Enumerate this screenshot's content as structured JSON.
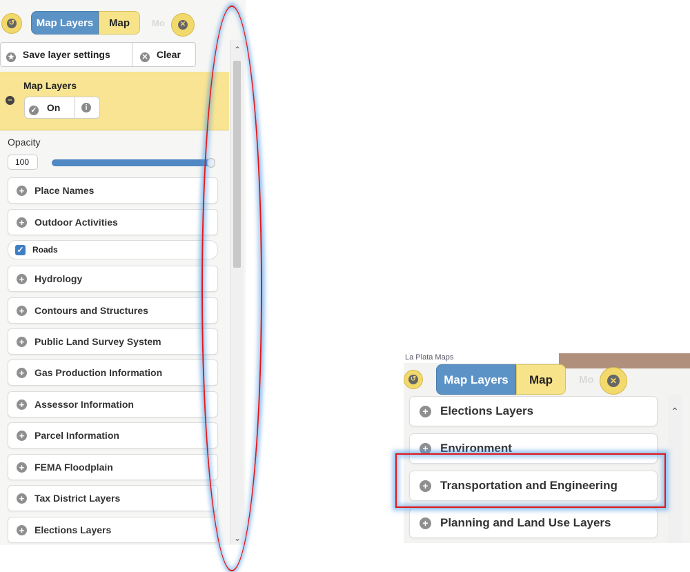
{
  "left_panel": {
    "tabs": {
      "active": "Map Layers",
      "inactive": "Map",
      "ghost": "Mo"
    },
    "toolbar": {
      "save_label": "Save layer settings",
      "clear_label": "Clear"
    },
    "layer_header": {
      "title": "Map Layers",
      "toggle_label": "On"
    },
    "opacity": {
      "label": "Opacity",
      "value": "100",
      "level_percent": 100
    },
    "groups": [
      "Place Names",
      "Outdoor Activities",
      "Hydrology",
      "Contours and Structures",
      "Public Land Survey System",
      "Gas Production Information",
      "Assessor Information",
      "Parcel Information",
      "FEMA Floodplain",
      "Tax District Layers",
      "Elections Layers"
    ],
    "checked_layer": {
      "label": "Roads",
      "checked": true
    }
  },
  "right_panel": {
    "window_title": "La Plata Maps",
    "tabs": {
      "active": "Map Layers",
      "inactive": "Map",
      "ghost": "Mo"
    },
    "groups": [
      "Elections Layers",
      "Environment",
      "Transportation and Engineering",
      "Planning and Land Use Layers"
    ],
    "highlighted": "Transportation and Engineering"
  },
  "colors": {
    "tab_active": "#5b93c7",
    "tab_inactive": "#f7e38a",
    "header_yellow": "#f8e492",
    "annotation_red": "#e01818",
    "annotation_glow": "#4696e6"
  }
}
